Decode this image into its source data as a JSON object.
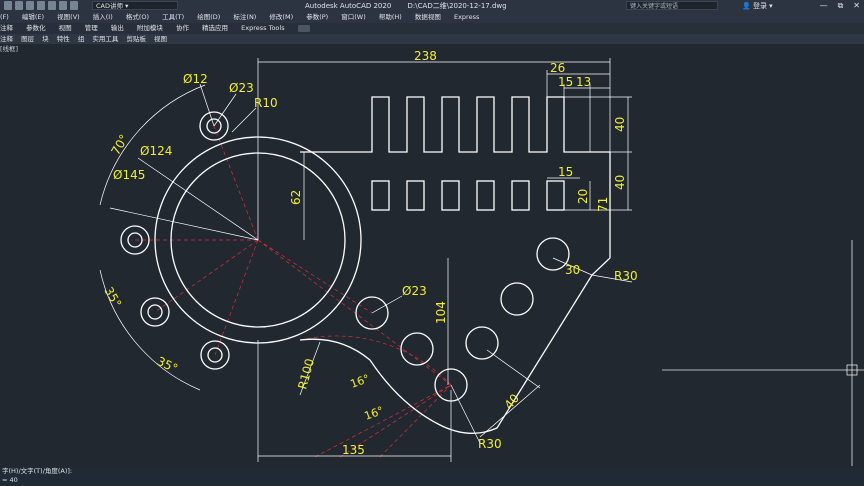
{
  "titlebar": {
    "app": "Autodesk AutoCAD 2020",
    "file": "D:\\CAD二维\\2020-12-17.dwg",
    "workspace": "CAD讲师",
    "search_placeholder": "键入关键字或短语",
    "login": "登录",
    "min": "—",
    "restore": "⧉",
    "close": "✕"
  },
  "menubar": {
    "items": [
      "(F)",
      "编辑(E)",
      "视图(V)",
      "插入(I)",
      "格式(O)",
      "工具(T)",
      "绘图(D)",
      "标注(N)",
      "修改(M)",
      "参数(P)",
      "窗口(W)",
      "帮助(H)",
      "数据视图",
      "Express"
    ]
  },
  "ribbon_tabs": {
    "items": [
      "注释",
      "参数化",
      "视图",
      "管理",
      "输出",
      "附加模块",
      "协作",
      "精选应用",
      "Express Tools"
    ]
  },
  "ribbon_panels": {
    "items": [
      "注释",
      "图层",
      "块",
      "特性",
      "组",
      "实用工具",
      "剪贴板",
      "视图"
    ]
  },
  "drawing_tab": {
    "label": "[线框]"
  },
  "command": {
    "line1": "字(H)/文字(T)/角度(A)]:",
    "line2": "= 40"
  },
  "dimensions": {
    "d238": "238",
    "d26": "26",
    "d15a": "15",
    "d13": "13",
    "d40a": "40",
    "d40b": "40",
    "d15b": "15",
    "d20": "20",
    "d71": "71",
    "d62": "62",
    "d30": "30",
    "r30a": "R30",
    "dia12": "Ø12",
    "dia23a": "Ø23",
    "r10": "R10",
    "dia124": "Ø124",
    "dia145": "Ø145",
    "a70": "70°",
    "a35a": "35°",
    "a35b": "35°",
    "dia23b": "Ø23",
    "d104": "104",
    "r100": "R100",
    "a16a": "16°",
    "a16b": "16°",
    "d40c": "40",
    "r30b": "R30",
    "d135": "135"
  },
  "colors": {
    "geometry": "#ffffff",
    "dimension": "#f2ef31",
    "centerline": "#e0303a",
    "background": "#212830"
  }
}
